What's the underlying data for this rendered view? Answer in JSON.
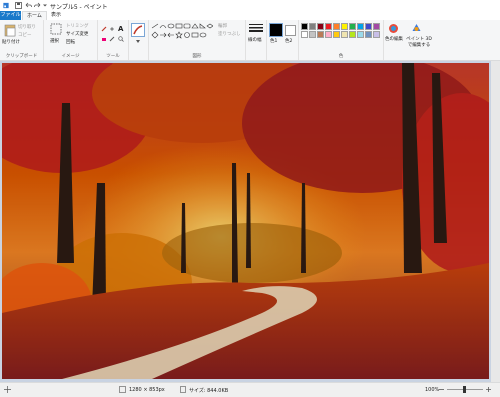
{
  "window": {
    "title": "サンプル5 - ペイント"
  },
  "tabs": {
    "file": "ファイル",
    "home": "ホーム",
    "view": "表示"
  },
  "ribbon": {
    "clipboard": {
      "paste": "貼り付け",
      "cut": "切り取り",
      "copy": "コピー",
      "label": "クリップボード"
    },
    "image": {
      "select": "選択",
      "crop": "トリミング",
      "resize": "サイズ変更",
      "rotate": "回転",
      "label": "イメージ"
    },
    "tools": {
      "label": "ツール"
    },
    "shapes": {
      "outline": "輪郭",
      "fill": "塗りつぶし",
      "label": "図形"
    },
    "size": {
      "label": "線の幅"
    },
    "color1": {
      "label": "色1"
    },
    "color2": {
      "label": "色2"
    },
    "colors": {
      "label": "色"
    },
    "edit_colors": "色の編集",
    "paint3d": "ペイント 3D で編集する"
  },
  "palette": [
    "#000000",
    "#7f7f7f",
    "#880015",
    "#ed1c24",
    "#ff7f27",
    "#fff200",
    "#22b14c",
    "#00a2e8",
    "#3f48cc",
    "#a349a4",
    "#ffffff",
    "#c3c3c3",
    "#b97a57",
    "#ffaec9",
    "#ffc90e",
    "#efe4b0",
    "#b5e61d",
    "#99d9ea",
    "#7092be",
    "#c8bfe7"
  ],
  "status": {
    "dimensions": "1280 × 853px",
    "size": "サイズ: 844.0KB",
    "zoom": "100%"
  }
}
